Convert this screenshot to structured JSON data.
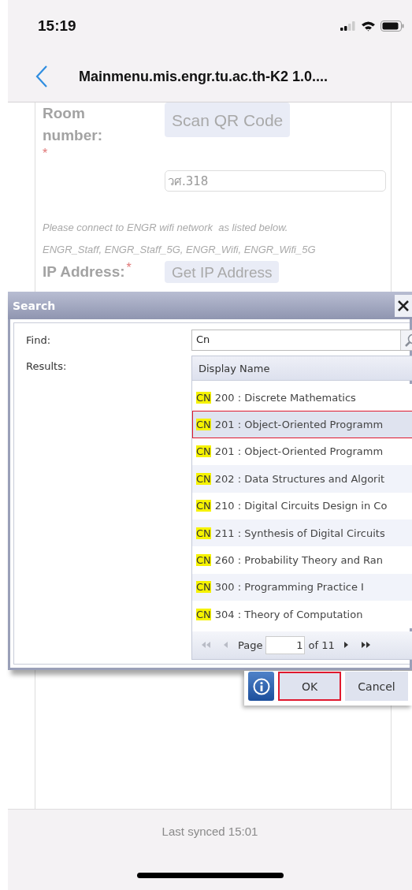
{
  "status_bar": {
    "time": "15:19"
  },
  "nav": {
    "title": "Mainmenu.mis.engr.tu.ac.th-K2 1.0...."
  },
  "form": {
    "room_label": "Room number:",
    "room_required_mark": "*",
    "scan_button": "Scan QR Code",
    "room_value": "วศ.318",
    "note_lines": [
      "Please connect to ENGR wifi network  as listed below.",
      "ENGR_Staff, ENGR_Staff_5G, ENGR_Wifi, ENGR_Wifi_5G"
    ],
    "ip_label": "IP Address:",
    "ip_required_mark": "*",
    "ip_button": "Get IP Address"
  },
  "dialog": {
    "title": "Search",
    "find_label": "Find:",
    "find_value": "Cn",
    "results_label": "Results:",
    "column": "Display Name",
    "rows": [
      {
        "match": "CN",
        "text": "200 : Discrete Mathematics",
        "selected": false
      },
      {
        "match": "CN",
        "text": "201 : Object-Oriented Programm",
        "selected": true
      },
      {
        "match": "CN",
        "text": "201 : Object-Oriented Programm",
        "selected": false
      },
      {
        "match": "CN",
        "text": "202 : Data Structures and Algorit",
        "selected": false
      },
      {
        "match": "CN",
        "text": "210 : Digital Circuits Design in Co",
        "selected": false
      },
      {
        "match": "CN",
        "text": "211 : Synthesis of Digital Circuits",
        "selected": false
      },
      {
        "match": "CN",
        "text": "260 : Probability Theory and Ran",
        "selected": false
      },
      {
        "match": "CN",
        "text": "300 : Programming Practice I",
        "selected": false
      },
      {
        "match": "CN",
        "text": "304 : Theory of Computation",
        "selected": false
      }
    ],
    "pager": {
      "first": {
        "disabled": true
      },
      "prev": {
        "disabled": true
      },
      "page_label": "Page",
      "page_value": "1",
      "total": "of 11",
      "next": {
        "disabled": false
      },
      "last": {
        "disabled": false
      }
    },
    "buttons": [
      {
        "kind": "info"
      },
      {
        "kind": "ok",
        "label": "OK",
        "focused": true
      },
      {
        "kind": "cancel",
        "label": "Cancel",
        "focused": false
      }
    ]
  },
  "footer": {
    "sync_status": "Last synced 15:01"
  }
}
